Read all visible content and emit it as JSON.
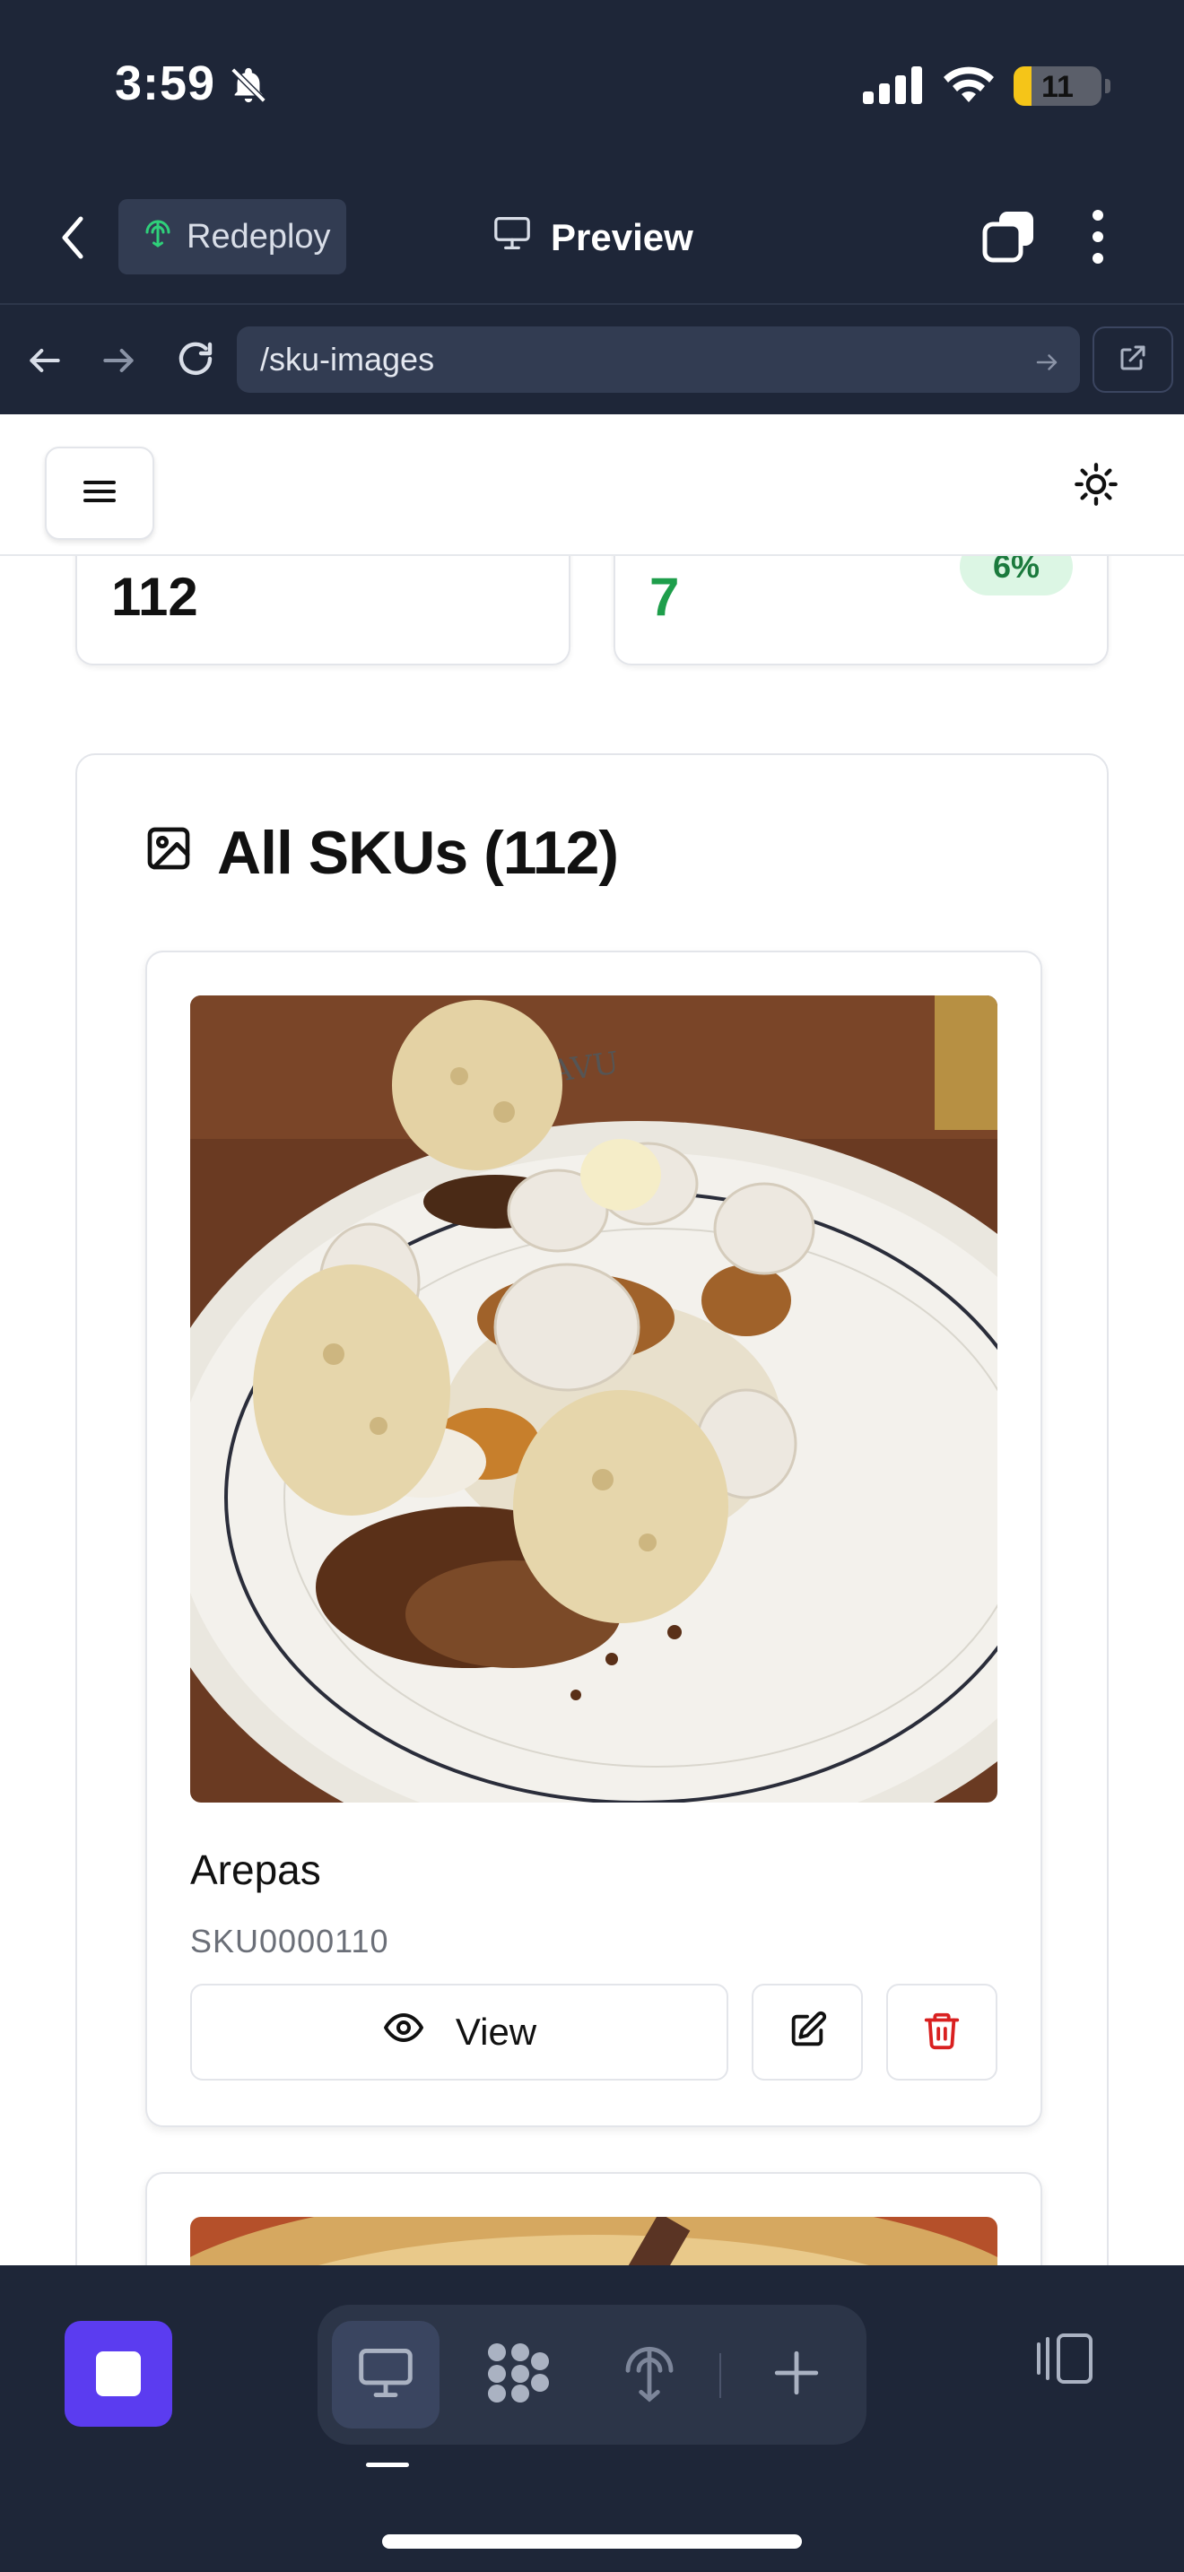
{
  "status_bar": {
    "time": "3:59",
    "battery_level": "11",
    "battery_fraction": 0.2
  },
  "app_bar": {
    "back_icon": "chevron-left-icon",
    "redeploy_label": "Redeploy",
    "preview_label": "Preview",
    "tabs_icon": "tabs-icon",
    "menu_icon": "more-vertical-icon"
  },
  "url_bar": {
    "path": "/sku-images"
  },
  "page": {
    "stats": [
      {
        "value": "112",
        "color": "#111111"
      },
      {
        "value": "7",
        "badge": "6%",
        "color": "#1e9e4b"
      }
    ],
    "section_title": "All SKUs (112)",
    "section_icon": "image-icon",
    "sku_cards": [
      {
        "name": "Arepas",
        "sku": "SKU0000110",
        "view_label": "View",
        "edit_icon": "edit-icon",
        "delete_icon": "trash-icon"
      }
    ]
  },
  "dock": {
    "tools": [
      "desktop-icon",
      "workflow-icon",
      "deploy-icon",
      "plus-icon"
    ],
    "accent": "#5b3cf0"
  }
}
